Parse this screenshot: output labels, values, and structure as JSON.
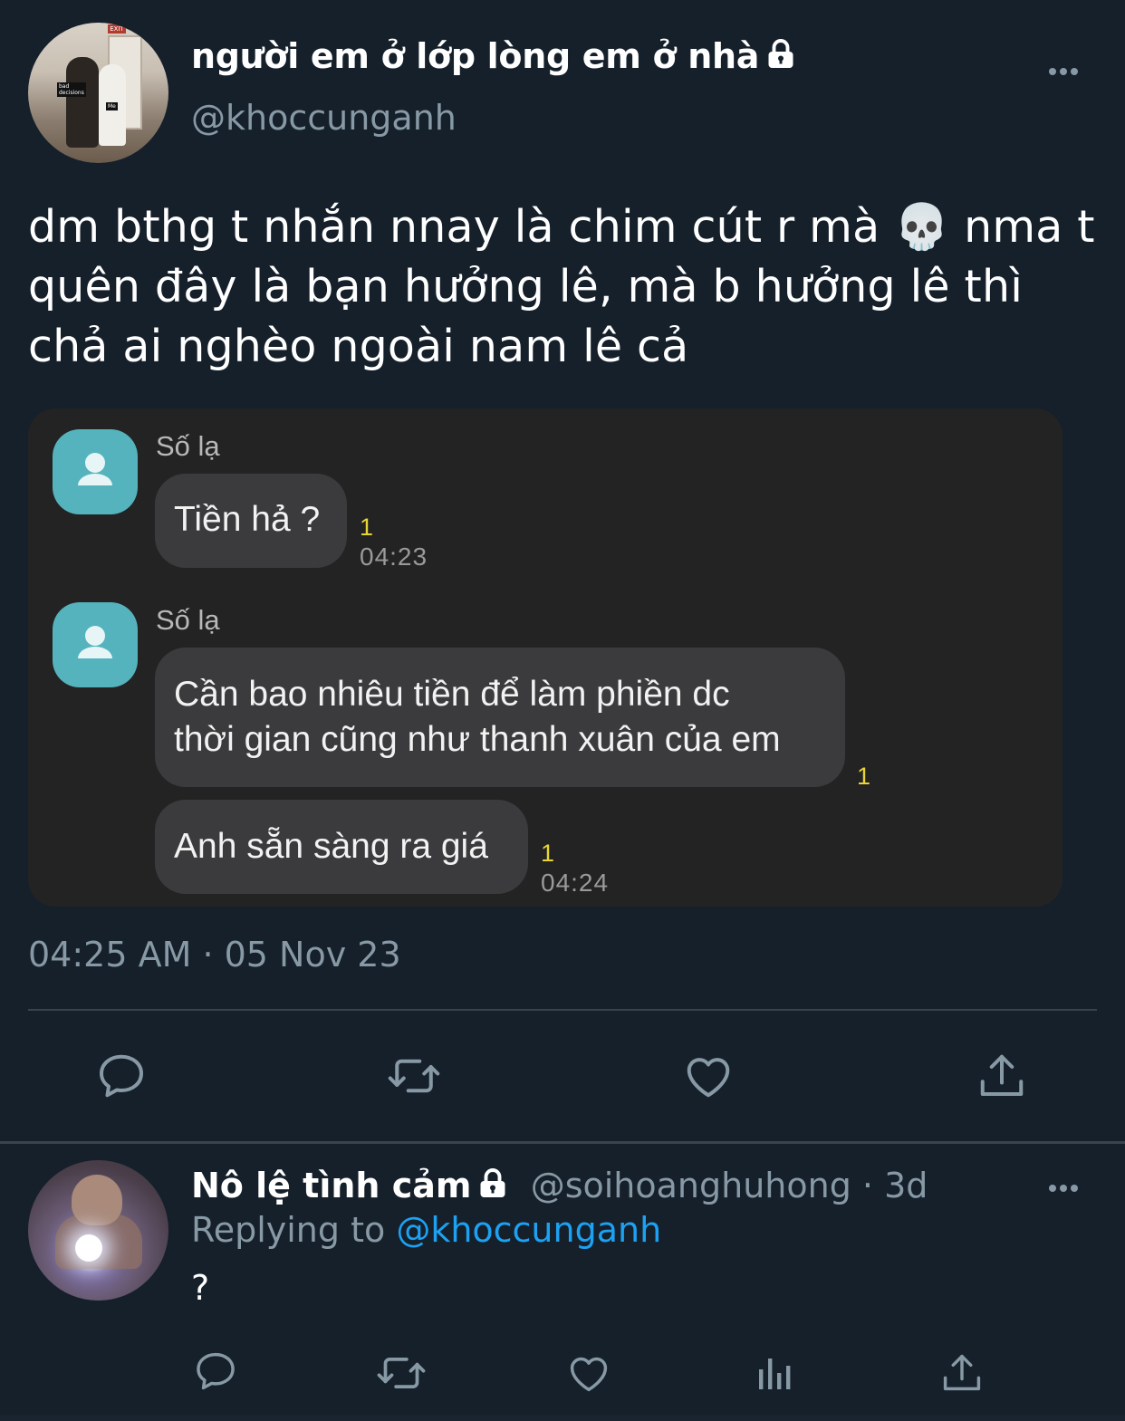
{
  "tweet": {
    "display_name": "người em ở lớp lòng em ở nhà",
    "handle": "@khoccunganh",
    "text_lines": [
      "dm bthg t nhắn nnay là chim cút r mà 💀 nma t",
      "quên đây là bạn hưởng lê, mà b hưởng lê thì",
      "chả ai nghèo ngoài nam lê cả"
    ],
    "timestamp": "04:25 AM · 05 Nov 23",
    "avatar_tags": {
      "exit": "EXIT",
      "left": "bad decisions",
      "right": "Me"
    }
  },
  "screenshot": {
    "messages": [
      {
        "sender": "Số lạ",
        "text": "Tiền hả ?",
        "unread": "1",
        "time": "04:23"
      },
      {
        "sender": "Số lạ",
        "lines": [
          "Cần bao nhiêu tiền để làm phiền dc",
          "thời gian cũng như thanh xuân của em"
        ],
        "unread": "1"
      },
      {
        "text": "Anh sẵn sàng ra giá",
        "unread": "1",
        "time": "04:24"
      }
    ]
  },
  "reply": {
    "display_name": "Nô lệ tình cảm",
    "handle_time": "@soihoanghuhong · 3d",
    "replying_prefix": "Replying to ",
    "replying_handle": "@khoccunganh",
    "text": "?"
  },
  "icons": {
    "main_actions": [
      "reply-icon",
      "retweet-icon",
      "like-icon",
      "share-icon"
    ],
    "reply_actions": [
      "reply-icon",
      "retweet-icon",
      "like-icon",
      "analytics-icon",
      "share-icon"
    ]
  },
  "colors": {
    "background": "#15202b",
    "secondary_text": "#8899a6",
    "accent": "#1da1f2",
    "unread_marker": "#e8d534",
    "sms_avatar": "#55b3bd"
  }
}
